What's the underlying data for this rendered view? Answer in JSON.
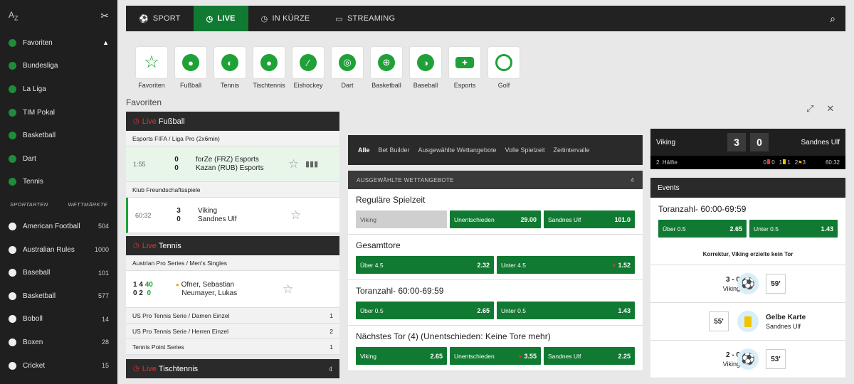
{
  "sidebar": {
    "az_label": "A",
    "az_sub": "Z",
    "favorites_label": "Favoriten",
    "favorites": [
      {
        "label": "Bundesliga"
      },
      {
        "label": "La Liga"
      },
      {
        "label": "TIM Pokal"
      },
      {
        "label": "Basketball"
      },
      {
        "label": "Dart"
      },
      {
        "label": "Tennis"
      }
    ],
    "sportarten_label": "SPORTARTEN",
    "wettmaerkte_label": "WETTMÄRKTE",
    "sports": [
      {
        "label": "American Football",
        "count": "504"
      },
      {
        "label": "Australian Rules",
        "count": "1000"
      },
      {
        "label": "Baseball",
        "count": "101"
      },
      {
        "label": "Basketball",
        "count": "577"
      },
      {
        "label": "Boboll",
        "count": "14"
      },
      {
        "label": "Boxen",
        "count": "28"
      },
      {
        "label": "Cricket",
        "count": "15"
      }
    ]
  },
  "topnav": {
    "items": [
      {
        "label": "SPORT",
        "icon": "soccer-icon"
      },
      {
        "label": "LIVE",
        "icon": "clock-icon"
      },
      {
        "label": "IN KÜRZE",
        "icon": "clock-icon"
      },
      {
        "label": "STREAMING",
        "icon": "monitor-icon"
      }
    ],
    "active": "LIVE",
    "accent": "#117a32"
  },
  "sport_icons": [
    {
      "label": "Favoriten",
      "icon": "star-icon"
    },
    {
      "label": "Fußball",
      "icon": "football-icon"
    },
    {
      "label": "Tennis",
      "icon": "tennis-icon"
    },
    {
      "label": "Tischtennis",
      "icon": "table-tennis-icon"
    },
    {
      "label": "Eishockey",
      "icon": "hockey-icon"
    },
    {
      "label": "Dart",
      "icon": "dart-icon"
    },
    {
      "label": "Basketball",
      "icon": "basketball-icon"
    },
    {
      "label": "Baseball",
      "icon": "baseball-icon"
    },
    {
      "label": "Esports",
      "icon": "gamepad-icon"
    },
    {
      "label": "Golf",
      "icon": "golf-icon"
    }
  ],
  "favorites_panel": {
    "title": "Favoriten",
    "live_label": "Live",
    "football": {
      "sport": "Fußball",
      "league1": "Esports FIFA / Liga Pro (2x6min)",
      "match1": {
        "time": "1:55",
        "score_home": "0",
        "score_away": "0",
        "home": "forZe (FRZ) Esports",
        "away": "Kazan (RUB) Esports"
      },
      "league2": "Klub Freundschaftsspiele",
      "match2": {
        "time": "60:32",
        "score_home": "3",
        "score_away": "0",
        "home": "Viking",
        "away": "Sandnes Ulf"
      }
    },
    "tennis": {
      "sport": "Tennis",
      "league1": "Austrian Pro Series / Men's Singles",
      "match1": {
        "home_sets": "1",
        "home_games": "4",
        "home_points": "40",
        "away_sets": "0",
        "away_games": "2",
        "away_points": "0",
        "home": "Ofner, Sebastian",
        "away": "Neumayer, Lukas"
      },
      "leagues": [
        {
          "name": "US Pro Tennis Serie / Damen Einzel",
          "count": "1"
        },
        {
          "name": "US Pro Tennis Serie / Herren Einzel",
          "count": "2"
        },
        {
          "name": "Tennis Point Series",
          "count": "1"
        }
      ]
    },
    "tischtennis": {
      "sport": "Tischtennis",
      "count": "4"
    }
  },
  "middle": {
    "tabs": [
      "Alle",
      "Bet Builder",
      "Ausgewählte Wettangebote",
      "Volle Spielzeit",
      "Zeitintervalle"
    ],
    "section_title": "AUSGEWÄHLTE WETTANGEBOTE",
    "section_count": "4",
    "markets": [
      {
        "title": "Reguläre Spielzeit",
        "odds": [
          {
            "label": "Viking",
            "value": ""
          },
          {
            "label": "Unentschieden",
            "value": "29.00"
          },
          {
            "label": "Sandnes Ulf",
            "value": "101.0"
          }
        ]
      },
      {
        "title": "Gesamttore",
        "odds": [
          {
            "label": "Über 4.5",
            "value": "2.32"
          },
          {
            "label": "Unter 4.5",
            "value": "1.52"
          }
        ]
      },
      {
        "title": "Toranzahl- 60:00-69:59",
        "odds": [
          {
            "label": "Über 0.5",
            "value": "2.65"
          },
          {
            "label": "Unter 0.5",
            "value": "1.43"
          }
        ]
      },
      {
        "title": "Nächstes Tor (4) (Unentschieden: Keine Tore mehr)",
        "odds": [
          {
            "label": "Viking",
            "value": "2.65"
          },
          {
            "label": "Unentschieden",
            "value": "3.55"
          },
          {
            "label": "Sandnes Ulf",
            "value": "2.25"
          }
        ]
      }
    ]
  },
  "right": {
    "home": "Viking",
    "away": "Sandnes Ulf",
    "score_home": "3",
    "score_away": "0",
    "half": "2. Hälfte",
    "red_home": "0",
    "red_away": "0",
    "yellow_home": "1",
    "yellow_away": "1",
    "corners_home": "2",
    "corners_away": "3",
    "clock": "60:32",
    "events_title": "Events",
    "market": {
      "title": "Toranzahl- 60:00-69:59",
      "over_label": "Über 0.5",
      "over_value": "2.65",
      "under_label": "Unter 0.5",
      "under_value": "1.43"
    },
    "correction": "Korrektur, Viking erzielte kein Tor",
    "events": [
      {
        "score": "3 - 0",
        "team": "Viking",
        "minute": "59'"
      },
      {
        "type": "Gelbe Karte",
        "team": "Sandnes Ulf",
        "minute": "55'"
      },
      {
        "score": "2 - 0",
        "team": "Viking",
        "minute": "53'"
      }
    ]
  }
}
